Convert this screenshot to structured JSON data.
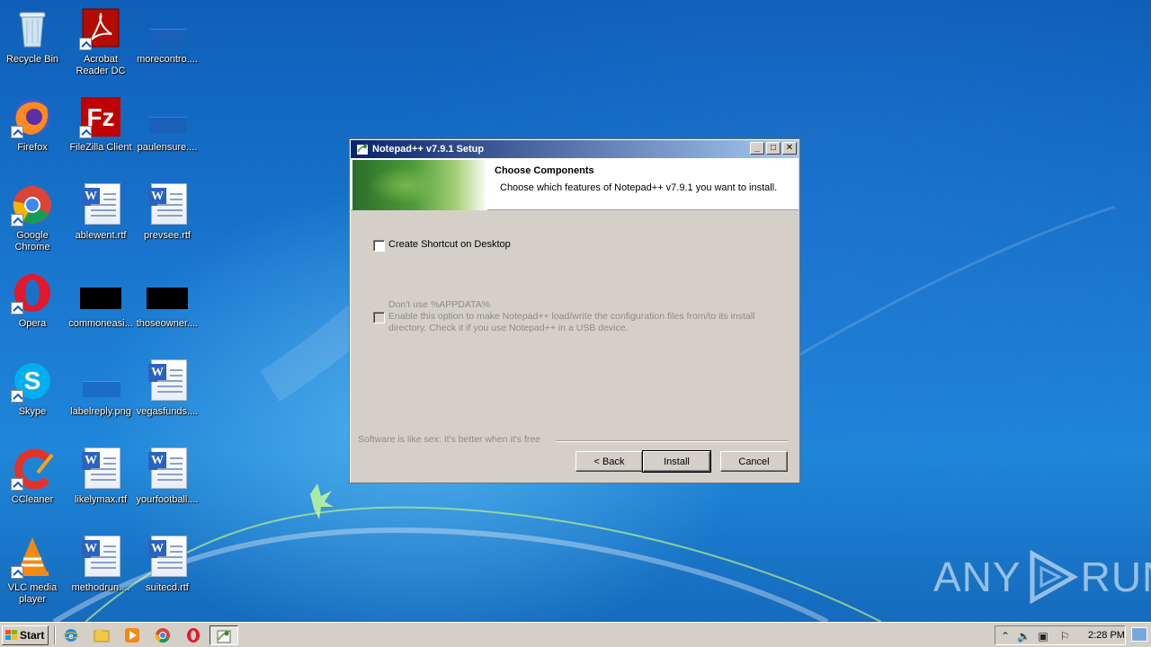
{
  "desktop": {
    "icons": [
      {
        "label": "Recycle Bin",
        "icon": "recycle-bin-icon"
      },
      {
        "label": "Acrobat Reader DC",
        "icon": "acrobat-reader-icon"
      },
      {
        "label": "morecontro....",
        "icon": "blank-document-icon"
      },
      {
        "label": "Firefox",
        "icon": "firefox-icon"
      },
      {
        "label": "FileZilla Client",
        "icon": "filezilla-icon"
      },
      {
        "label": "paulensure....",
        "icon": "blank-document-icon"
      },
      {
        "label": "Google Chrome",
        "icon": "chrome-icon"
      },
      {
        "label": "ablewent.rtf",
        "icon": "word-document-icon"
      },
      {
        "label": "prevsee.rtf",
        "icon": "word-document-icon"
      },
      {
        "label": "Opera",
        "icon": "opera-icon"
      },
      {
        "label": "commoneasi...",
        "icon": "black-image-icon"
      },
      {
        "label": "thoseowner....",
        "icon": "black-image-icon"
      },
      {
        "label": "Skype",
        "icon": "skype-icon"
      },
      {
        "label": "labelreply.png",
        "icon": "image-file-icon"
      },
      {
        "label": "vegasfunds....",
        "icon": "word-document-icon"
      },
      {
        "label": "CCleaner",
        "icon": "ccleaner-icon"
      },
      {
        "label": "likelymax.rtf",
        "icon": "word-document-icon"
      },
      {
        "label": "yourfootball....",
        "icon": "word-document-icon"
      },
      {
        "label": "VLC media player",
        "icon": "vlc-icon"
      },
      {
        "label": "methodrun....",
        "icon": "word-document-icon"
      },
      {
        "label": "suitecd.rtf",
        "icon": "word-document-icon"
      }
    ]
  },
  "window": {
    "title": "Notepad++ v7.9.1 Setup",
    "controls": {
      "minimize": "_",
      "maximize": "□",
      "close": "✕"
    },
    "header": {
      "title": "Choose Components",
      "subtitle": "Choose which features of Notepad++ v7.9.1 you want to install."
    },
    "options": {
      "shortcut_label": "Create Shortcut on Desktop",
      "appdata_title": "Don't use %APPDATA%",
      "appdata_desc": "Enable this option to make Notepad++ load/write the configuration files from/to its install directory. Check it if you use Notepad++ in a USB device."
    },
    "branding": "Software is like sex: It's better when it's free",
    "buttons": {
      "back": "< Back",
      "install": "Install",
      "cancel": "Cancel"
    }
  },
  "taskbar": {
    "start_label": "Start",
    "clock": "2:28 PM"
  },
  "watermark": {
    "left": "ANY",
    "right": "RUN"
  }
}
